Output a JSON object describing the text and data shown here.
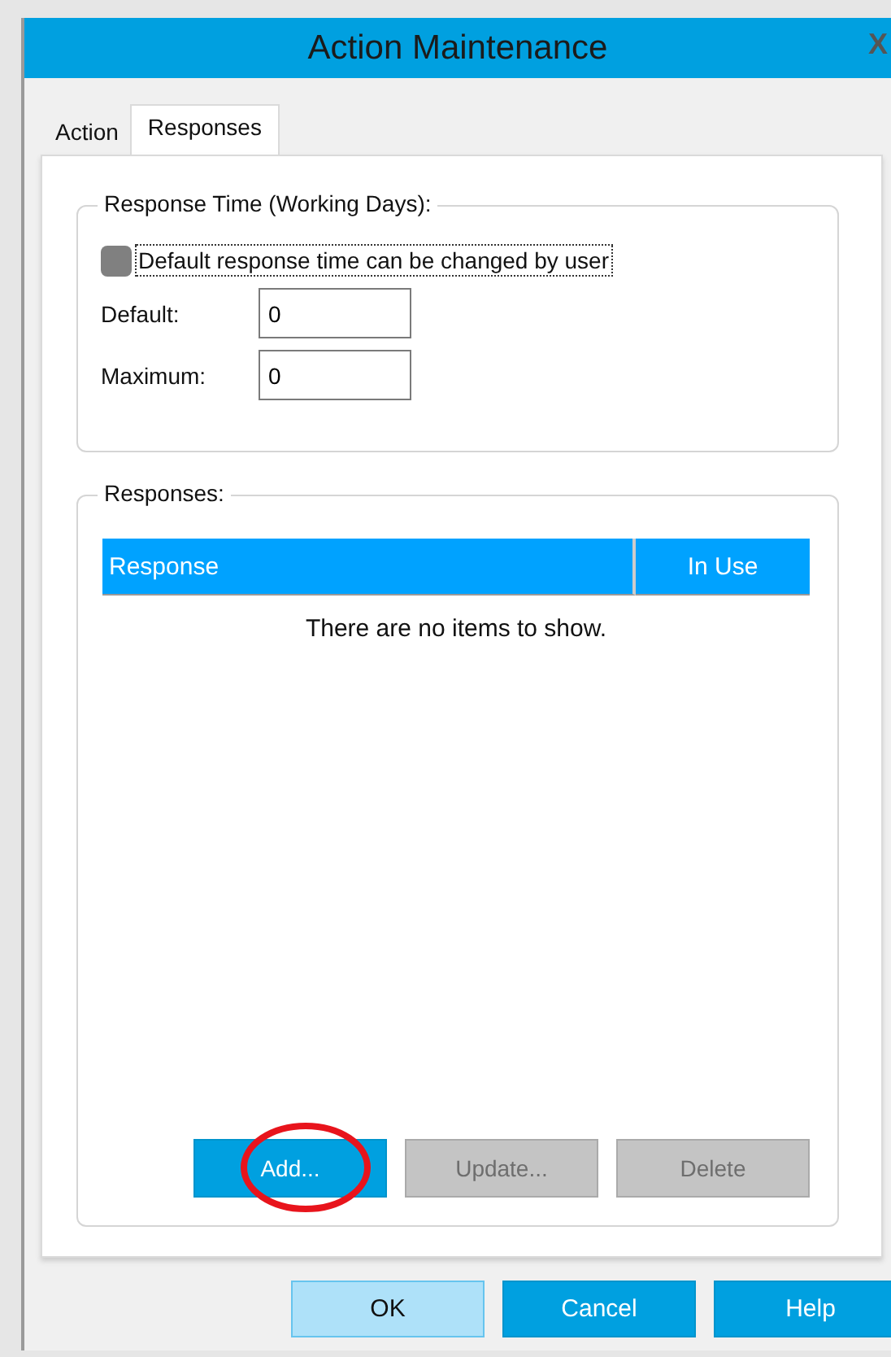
{
  "window": {
    "title": "Action Maintenance",
    "close": "X"
  },
  "tabs": [
    {
      "label": "Action",
      "selected": false
    },
    {
      "label": "Responses",
      "selected": true
    }
  ],
  "response_time": {
    "title": "Response Time (Working Days):",
    "checkbox": {
      "label": "Default response time can be changed by user",
      "checked": false,
      "focused": true
    },
    "fields": [
      {
        "label": "Default:",
        "value": "0"
      },
      {
        "label": "Maximum:",
        "value": "0"
      }
    ]
  },
  "responses": {
    "title": "Responses:",
    "columns": [
      "Response",
      "In Use"
    ],
    "empty_text": "There are no items to show.",
    "buttons": [
      {
        "label": "Add...",
        "disabled": false,
        "circled": true
      },
      {
        "label": "Update...",
        "disabled": true,
        "circled": false
      },
      {
        "label": "Delete",
        "disabled": true,
        "circled": false
      }
    ]
  },
  "buttons": [
    {
      "label": "OK",
      "default": true
    },
    {
      "label": "Cancel",
      "default": false
    },
    {
      "label": "Help",
      "default": false
    }
  ]
}
